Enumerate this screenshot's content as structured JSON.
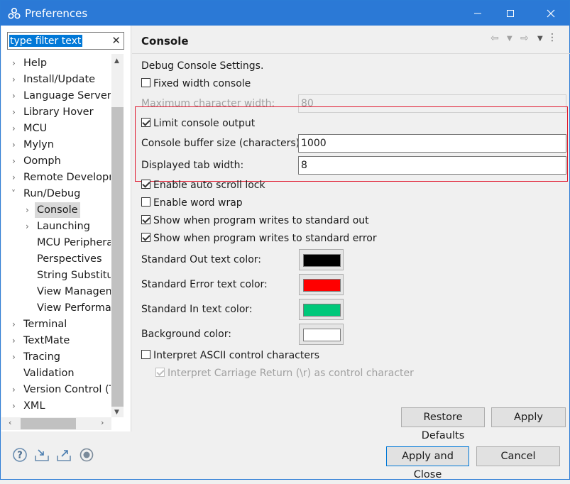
{
  "window": {
    "title": "Preferences"
  },
  "filter": {
    "value": "type filter text"
  },
  "tree": [
    {
      "label": "Help",
      "chev": "›"
    },
    {
      "label": "Install/Update",
      "chev": "›"
    },
    {
      "label": "Language Servers",
      "chev": "›"
    },
    {
      "label": "Library Hover",
      "chev": "›"
    },
    {
      "label": "MCU",
      "chev": "›"
    },
    {
      "label": "Mylyn",
      "chev": "›"
    },
    {
      "label": "Oomph",
      "chev": "›"
    },
    {
      "label": "Remote Developm",
      "chev": "›"
    },
    {
      "label": "Run/Debug",
      "chev": "˅"
    },
    {
      "label": "Console",
      "chev": "›"
    },
    {
      "label": "Launching",
      "chev": "›"
    },
    {
      "label": "MCU Periphera",
      "chev": ""
    },
    {
      "label": "Perspectives",
      "chev": ""
    },
    {
      "label": "String Substitut",
      "chev": ""
    },
    {
      "label": "View Managem",
      "chev": ""
    },
    {
      "label": "View Performar",
      "chev": ""
    },
    {
      "label": "Terminal",
      "chev": "›"
    },
    {
      "label": "TextMate",
      "chev": "›"
    },
    {
      "label": "Tracing",
      "chev": "›"
    },
    {
      "label": "Validation",
      "chev": ""
    },
    {
      "label": "Version Control (Te",
      "chev": "›"
    },
    {
      "label": "XML",
      "chev": "›"
    }
  ],
  "page": {
    "title": "Console",
    "section": "Debug Console Settings.",
    "fixed_width": "Fixed width console",
    "max_char_width_label": "Maximum character width:",
    "max_char_width_value": "80",
    "limit_output": "Limit console output",
    "buffer_label": "Console buffer size (characters):",
    "buffer_value": "1000",
    "tab_label": "Displayed tab width:",
    "tab_value": "8",
    "auto_scroll": "Enable auto scroll lock",
    "word_wrap": "Enable word wrap",
    "show_out": "Show when program writes to standard out",
    "show_err": "Show when program writes to standard error",
    "std_out_color_label": "Standard Out text color:",
    "std_err_color_label": "Standard Error text color:",
    "std_in_color_label": "Standard In text color:",
    "bg_color_label": "Background color:",
    "interpret_ascii": "Interpret ASCII control characters",
    "interpret_cr": "Interpret Carriage Return (\\r) as control character",
    "restore_defaults": "Restore Defaults",
    "apply": "Apply"
  },
  "colors": {
    "std_out": "#000000",
    "std_err": "#ff0000",
    "std_in": "#00c87a",
    "background": "#ffffff",
    "highlight": "#e0182e"
  },
  "footer": {
    "apply_close": "Apply and Close",
    "cancel": "Cancel"
  }
}
